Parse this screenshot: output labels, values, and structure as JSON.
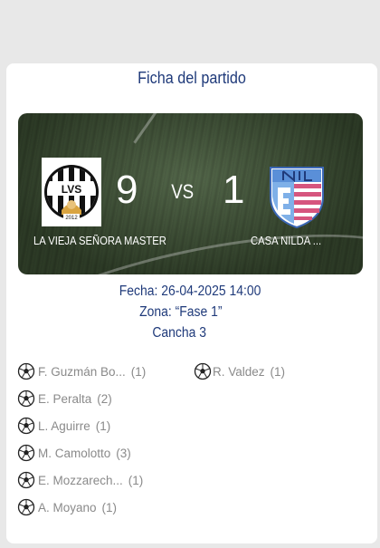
{
  "page": {
    "title": "Ficha del partido"
  },
  "match": {
    "home": {
      "name": "LA VIEJA SEÑORA MASTER",
      "score": "9",
      "logo_text": "LVS",
      "logo_year": "2012"
    },
    "vs_label": "VS",
    "away": {
      "name": "CASA NILDA ...",
      "score": "1"
    },
    "fecha": "Fecha: 26-04-2025 14:00",
    "zona": "Zona: “Fase 1”",
    "cancha": "Cancha 3"
  },
  "scorers": {
    "home": [
      {
        "name": "F. Guzmán Bo...",
        "goals": "(1)"
      },
      {
        "name": "E. Peralta",
        "goals": "(2)"
      },
      {
        "name": "L. Aguirre",
        "goals": "(1)"
      },
      {
        "name": "M. Camolotto",
        "goals": "(3)"
      },
      {
        "name": "E. Mozzarech...",
        "goals": "(1)"
      },
      {
        "name": "A. Moyano",
        "goals": "(1)"
      }
    ],
    "away": [
      {
        "name": "R. Valdez",
        "goals": "(1)"
      }
    ]
  },
  "icons": {
    "scorer": "soccer-ball-icon"
  },
  "colors": {
    "accent": "#1f3a7a",
    "muted_text": "#8a8a8a",
    "background": "#e8e8e8"
  }
}
